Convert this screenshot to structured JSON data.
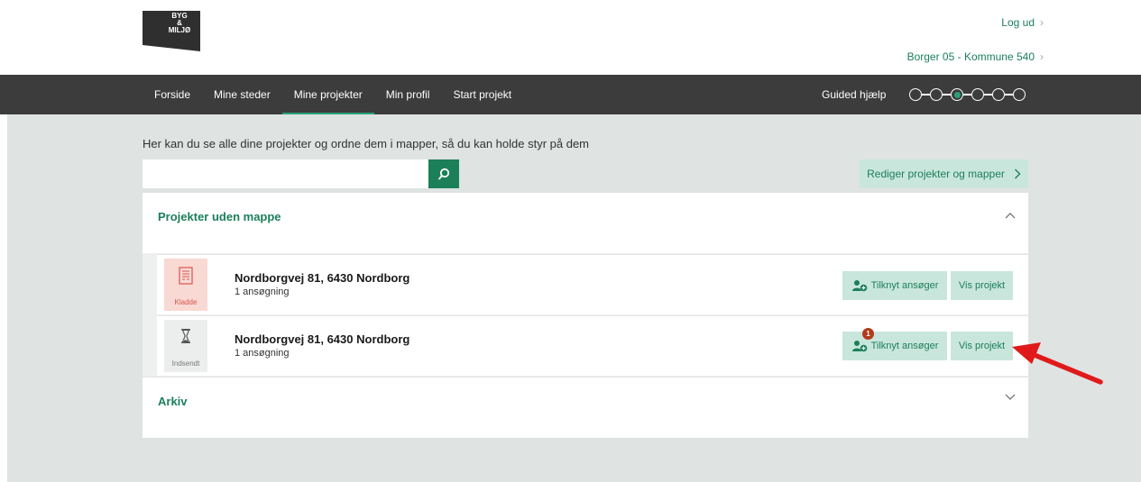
{
  "header": {
    "logo_line1": "BYG",
    "logo_line2": "&",
    "logo_line3": "MILJØ",
    "logout_label": "Log ud",
    "user_label": "Borger 05 - Kommune 540"
  },
  "nav": {
    "items": [
      {
        "label": "Forside"
      },
      {
        "label": "Mine steder"
      },
      {
        "label": "Mine projekter"
      },
      {
        "label": "Min profil"
      },
      {
        "label": "Start projekt"
      }
    ],
    "active_index": 2,
    "guided_label": "Guided hjælp",
    "step_count": 6,
    "active_step": 3
  },
  "main": {
    "intro": "Her kan du se alle dine projekter og ordne dem i mapper, så du kan holde styr på dem",
    "search_value": "",
    "edit_button": "Rediger projekter og mapper",
    "group_no_folder": "Projekter uden mappe",
    "group_archive": "Arkiv",
    "projects": [
      {
        "status": "Kladde",
        "address": "Nordborgvej 81, 6430 Nordborg",
        "count": "1 ansøgning",
        "attach_label": "Tilknyt ansøger",
        "view_label": "Vis projekt"
      },
      {
        "status": "Indsendt",
        "address": "Nordborgvej 81, 6430 Nordborg",
        "count": "1 ansøgning",
        "attach_label": "Tilknyt ansøger",
        "view_label": "Vis projekt",
        "badge": "1"
      }
    ]
  },
  "colors": {
    "brand_green": "#1b7f5a",
    "nav_dark": "#3c3c3c",
    "button_mint": "#c9e6dc",
    "badge_red": "#b13b1a",
    "arrow_red": "#e01a1a"
  }
}
